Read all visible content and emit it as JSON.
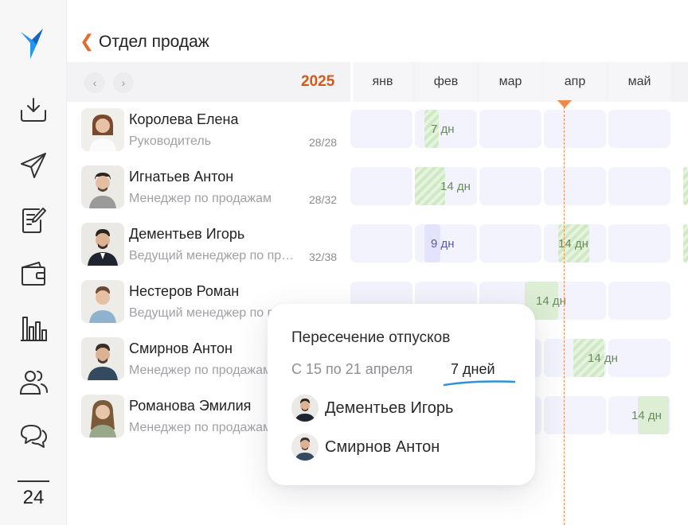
{
  "sidebar": {
    "items": [
      {
        "icon": "inbox-download-icon"
      },
      {
        "icon": "send-icon"
      },
      {
        "icon": "document-edit-icon"
      },
      {
        "icon": "wallet-icon"
      },
      {
        "icon": "bar-chart-icon"
      },
      {
        "icon": "users-icon"
      },
      {
        "icon": "chat-icon"
      }
    ],
    "calendar_day": "24"
  },
  "header": {
    "back_icon": "chevron-left-icon",
    "title": "Отдел продаж"
  },
  "timeline": {
    "year": "2025",
    "prev_icon": "chevron-left-icon",
    "next_icon": "chevron-right-icon",
    "months": [
      "янв",
      "фев",
      "мар",
      "апр",
      "май"
    ]
  },
  "employees": [
    {
      "name": "Королева Елена",
      "role": "Руководитель",
      "count": "28/28"
    },
    {
      "name": "Игнатьев Антон",
      "role": "Менеджер по продажам",
      "count": "28/32"
    },
    {
      "name": "Дементьев Игорь",
      "role": "Ведущий менеджер по продажам",
      "count": "32/38"
    },
    {
      "name": "Нестеров Роман",
      "role": "Ведущий менеджер по продажам",
      "count": ""
    },
    {
      "name": "Смирнов Антон",
      "role": "Менеджер по продажам",
      "count": ""
    },
    {
      "name": "Романова Эмилия",
      "role": "Менеджер по продажам",
      "count": ""
    }
  ],
  "vacations": {
    "row0": "7 дн",
    "row1": "14 дн",
    "row2a": "9 дн",
    "row2b": "14 дн",
    "row3": "14 дн",
    "row4": "14 дн",
    "row5": "14 дн"
  },
  "tooltip": {
    "title": "Пересечение отпусков",
    "range": "С 15 по 21 апреля",
    "days": "7 дней",
    "people": [
      "Дементьев Игорь",
      "Смирнов Антон"
    ]
  },
  "colors": {
    "accent": "#e46b2c",
    "year": "#d45a17",
    "today_line": "#f08a4b",
    "vacation_green": "#dcefd5",
    "vacation_blue": "#e3e3fb",
    "cell": "#f2f3fc"
  }
}
